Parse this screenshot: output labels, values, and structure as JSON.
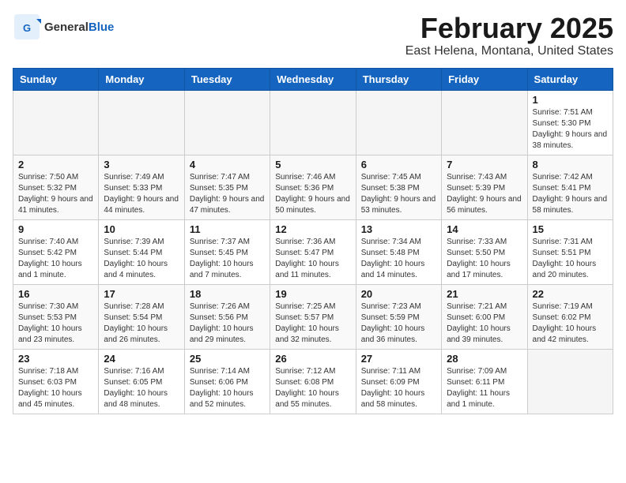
{
  "header": {
    "logo_general": "General",
    "logo_blue": "Blue",
    "title": "February 2025",
    "subtitle": "East Helena, Montana, United States"
  },
  "calendar": {
    "weekdays": [
      "Sunday",
      "Monday",
      "Tuesday",
      "Wednesday",
      "Thursday",
      "Friday",
      "Saturday"
    ],
    "weeks": [
      [
        {
          "day": "",
          "info": ""
        },
        {
          "day": "",
          "info": ""
        },
        {
          "day": "",
          "info": ""
        },
        {
          "day": "",
          "info": ""
        },
        {
          "day": "",
          "info": ""
        },
        {
          "day": "",
          "info": ""
        },
        {
          "day": "1",
          "info": "Sunrise: 7:51 AM\nSunset: 5:30 PM\nDaylight: 9 hours and 38 minutes."
        }
      ],
      [
        {
          "day": "2",
          "info": "Sunrise: 7:50 AM\nSunset: 5:32 PM\nDaylight: 9 hours and 41 minutes."
        },
        {
          "day": "3",
          "info": "Sunrise: 7:49 AM\nSunset: 5:33 PM\nDaylight: 9 hours and 44 minutes."
        },
        {
          "day": "4",
          "info": "Sunrise: 7:47 AM\nSunset: 5:35 PM\nDaylight: 9 hours and 47 minutes."
        },
        {
          "day": "5",
          "info": "Sunrise: 7:46 AM\nSunset: 5:36 PM\nDaylight: 9 hours and 50 minutes."
        },
        {
          "day": "6",
          "info": "Sunrise: 7:45 AM\nSunset: 5:38 PM\nDaylight: 9 hours and 53 minutes."
        },
        {
          "day": "7",
          "info": "Sunrise: 7:43 AM\nSunset: 5:39 PM\nDaylight: 9 hours and 56 minutes."
        },
        {
          "day": "8",
          "info": "Sunrise: 7:42 AM\nSunset: 5:41 PM\nDaylight: 9 hours and 58 minutes."
        }
      ],
      [
        {
          "day": "9",
          "info": "Sunrise: 7:40 AM\nSunset: 5:42 PM\nDaylight: 10 hours and 1 minute."
        },
        {
          "day": "10",
          "info": "Sunrise: 7:39 AM\nSunset: 5:44 PM\nDaylight: 10 hours and 4 minutes."
        },
        {
          "day": "11",
          "info": "Sunrise: 7:37 AM\nSunset: 5:45 PM\nDaylight: 10 hours and 7 minutes."
        },
        {
          "day": "12",
          "info": "Sunrise: 7:36 AM\nSunset: 5:47 PM\nDaylight: 10 hours and 11 minutes."
        },
        {
          "day": "13",
          "info": "Sunrise: 7:34 AM\nSunset: 5:48 PM\nDaylight: 10 hours and 14 minutes."
        },
        {
          "day": "14",
          "info": "Sunrise: 7:33 AM\nSunset: 5:50 PM\nDaylight: 10 hours and 17 minutes."
        },
        {
          "day": "15",
          "info": "Sunrise: 7:31 AM\nSunset: 5:51 PM\nDaylight: 10 hours and 20 minutes."
        }
      ],
      [
        {
          "day": "16",
          "info": "Sunrise: 7:30 AM\nSunset: 5:53 PM\nDaylight: 10 hours and 23 minutes."
        },
        {
          "day": "17",
          "info": "Sunrise: 7:28 AM\nSunset: 5:54 PM\nDaylight: 10 hours and 26 minutes."
        },
        {
          "day": "18",
          "info": "Sunrise: 7:26 AM\nSunset: 5:56 PM\nDaylight: 10 hours and 29 minutes."
        },
        {
          "day": "19",
          "info": "Sunrise: 7:25 AM\nSunset: 5:57 PM\nDaylight: 10 hours and 32 minutes."
        },
        {
          "day": "20",
          "info": "Sunrise: 7:23 AM\nSunset: 5:59 PM\nDaylight: 10 hours and 36 minutes."
        },
        {
          "day": "21",
          "info": "Sunrise: 7:21 AM\nSunset: 6:00 PM\nDaylight: 10 hours and 39 minutes."
        },
        {
          "day": "22",
          "info": "Sunrise: 7:19 AM\nSunset: 6:02 PM\nDaylight: 10 hours and 42 minutes."
        }
      ],
      [
        {
          "day": "23",
          "info": "Sunrise: 7:18 AM\nSunset: 6:03 PM\nDaylight: 10 hours and 45 minutes."
        },
        {
          "day": "24",
          "info": "Sunrise: 7:16 AM\nSunset: 6:05 PM\nDaylight: 10 hours and 48 minutes."
        },
        {
          "day": "25",
          "info": "Sunrise: 7:14 AM\nSunset: 6:06 PM\nDaylight: 10 hours and 52 minutes."
        },
        {
          "day": "26",
          "info": "Sunrise: 7:12 AM\nSunset: 6:08 PM\nDaylight: 10 hours and 55 minutes."
        },
        {
          "day": "27",
          "info": "Sunrise: 7:11 AM\nSunset: 6:09 PM\nDaylight: 10 hours and 58 minutes."
        },
        {
          "day": "28",
          "info": "Sunrise: 7:09 AM\nSunset: 6:11 PM\nDaylight: 11 hours and 1 minute."
        },
        {
          "day": "",
          "info": ""
        }
      ]
    ]
  }
}
